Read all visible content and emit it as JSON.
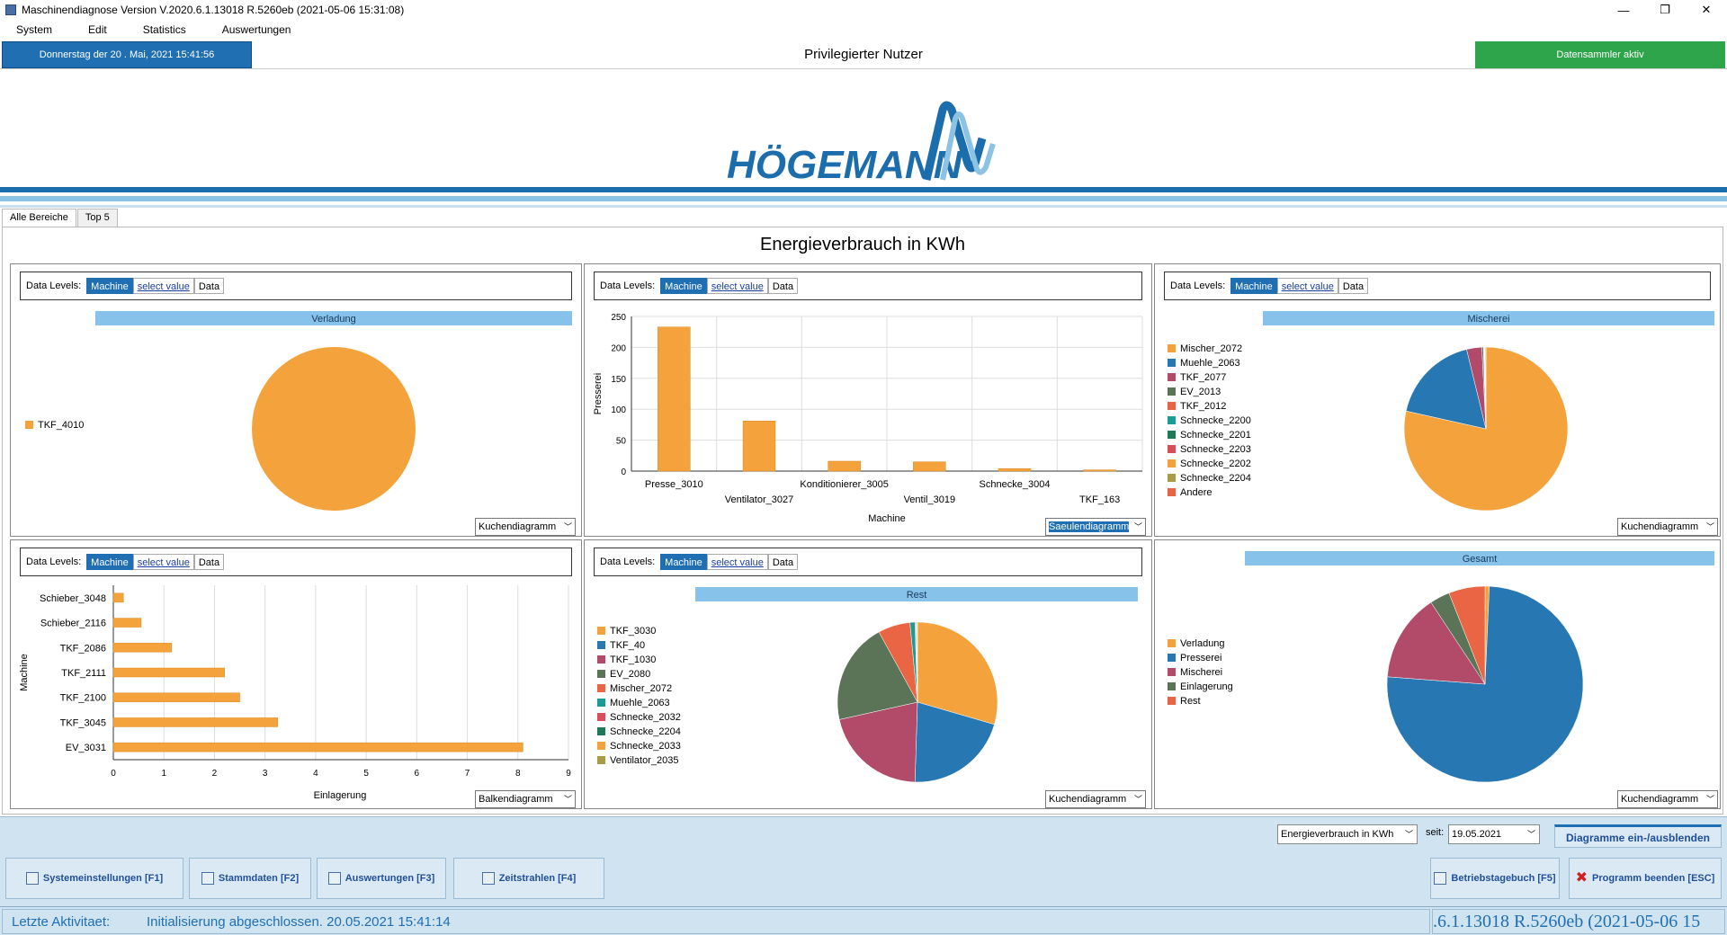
{
  "window": {
    "title": "Maschinendiagnose Version V.2020.6.1.13018 R.5260eb (2021-05-06 15:31:08)",
    "controls": [
      "—",
      "❐",
      "✕"
    ]
  },
  "menu": [
    "System",
    "Edit",
    "Statistics",
    "Auswertungen"
  ],
  "infobar": {
    "date": "Donnerstag  der  20 . Mai, 2021  15:41:56",
    "user": "Privilegierter Nutzer",
    "collector": "Datensammler aktiv"
  },
  "logo": {
    "text": "HÖGEMANN"
  },
  "tabs": [
    "Alle Bereiche",
    "Top 5"
  ],
  "main_title": "Energieverbrauch in KWh",
  "datalevels": {
    "label": "Data Levels:",
    "machine": "Machine",
    "select": "select value",
    "data": "Data"
  },
  "colors": {
    "orange": "#f4a23c",
    "blue": "#2677b2",
    "magenta": "#b24a6a",
    "green": "#5b7357",
    "red": "#ea6543",
    "teal": "#1a9c96",
    "darkgreen": "#1c7a58",
    "olive": "#a89c46",
    "header": "#86c2ea"
  },
  "panels": [
    {
      "header": "Verladung",
      "dropdown": "Kuchendiagramm",
      "chart_data": {
        "type": "pie",
        "title": "Verladung",
        "labels": [
          "TKF_4010"
        ],
        "values": [
          100
        ],
        "colors": [
          "#f4a23c"
        ]
      }
    },
    {
      "dropdown": "Saeulendiagramm",
      "chart_data": {
        "type": "bar",
        "xlabel": "Machine",
        "ylabel": "Presserei",
        "ylim": [
          0,
          250
        ],
        "yticks": [
          0,
          50,
          100,
          150,
          200,
          250
        ],
        "categories": [
          "Presse_3010",
          "Ventilator_3027",
          "Konditionierer_3005",
          "Ventil_3019",
          "Schnecke_3004",
          "TKF_163"
        ],
        "values": [
          233,
          81,
          16,
          15,
          4,
          2
        ]
      }
    },
    {
      "header": "Mischerei",
      "dropdown": "Kuchendiagramm",
      "chart_data": {
        "type": "pie",
        "title": "Mischerei",
        "labels": [
          "Mischer_2072",
          "Muehle_2063",
          "TKF_2077",
          "EV_2013",
          "TKF_2012",
          "Schnecke_2200",
          "Schnecke_2201",
          "Schnecke_2203",
          "Schnecke_2202",
          "Schnecke_2204",
          "Andere"
        ],
        "values": [
          78.5,
          17.7,
          3.0,
          0.3,
          0.1,
          0.05,
          0.05,
          0.05,
          0.05,
          0.1,
          0.1
        ],
        "colors": [
          "#f4a23c",
          "#2677b2",
          "#b24a6a",
          "#5b7357",
          "#ea6543",
          "#1a9c96",
          "#1c7a58",
          "#d94c5a",
          "#f4a23c",
          "#a89c46",
          "#ea6543"
        ]
      }
    },
    {
      "dropdown": "Balkendiagramm",
      "chart_data": {
        "type": "bar",
        "orientation": "horizontal",
        "xlabel": "Einlagerung",
        "ylabel": "Machine",
        "xlim": [
          0,
          9
        ],
        "xticks": [
          0,
          1,
          2,
          3,
          4,
          5,
          6,
          7,
          8,
          9
        ],
        "categories": [
          "Schieber_3048",
          "Schieber_2116",
          "TKF_2086",
          "TKF_2111",
          "TKF_2100",
          "TKF_3045",
          "EV_3031"
        ],
        "values": [
          0.2,
          0.55,
          1.15,
          2.2,
          2.5,
          3.25,
          8.1
        ]
      }
    },
    {
      "header": "Rest",
      "dropdown": "Kuchendiagramm",
      "chart_data": {
        "type": "pie",
        "title": "Rest",
        "labels": [
          "TKF_3030",
          "TKF_40",
          "TKF_1030",
          "EV_2080",
          "Mischer_2072",
          "Muehle_2063",
          "Schnecke_2032",
          "Schnecke_2204",
          "Schnecke_2033",
          "Ventilator_2035"
        ],
        "values": [
          29.5,
          21,
          21,
          20.5,
          6.5,
          1,
          0.15,
          0.15,
          0.1,
          0.1
        ],
        "colors": [
          "#f4a23c",
          "#2677b2",
          "#b24a6a",
          "#5b7357",
          "#ea6543",
          "#1a9c96",
          "#d94c5a",
          "#1c7a58",
          "#f4a23c",
          "#a89c46"
        ]
      }
    },
    {
      "header": "Gesamt",
      "dropdown": "Kuchendiagramm",
      "chart_data": {
        "type": "pie",
        "title": "Gesamt",
        "labels": [
          "Verladung",
          "Presserei",
          "Mischerei",
          "Einlagerung",
          "Rest"
        ],
        "values": [
          0.7,
          75.5,
          14.5,
          3.3,
          6.0
        ],
        "colors": [
          "#f4a23c",
          "#2677b2",
          "#b24a6a",
          "#5b7357",
          "#ea6543"
        ]
      }
    }
  ],
  "controls": {
    "metric": "Energieverbrauch in KWh",
    "seit_label": "seit:",
    "seit_date": "19.05.2021",
    "toggle": "Diagramme ein-/ausblenden"
  },
  "buttons": {
    "systemeinstellungen": "Systemeinstellungen [F1]",
    "stammdaten": "Stammdaten [F2]",
    "auswertungen": "Auswertungen [F3]",
    "zeitstrahlen": "Zeitstrahlen [F4]",
    "betriebstagebuch": "Betriebstagebuch [F5]",
    "beenden": "Programm beenden [ESC]"
  },
  "status": {
    "label": "Letzte Aktivitaet:",
    "text": "Initialisierung abgeschlossen. 20.05.2021 15:41:14",
    "version": ".6.1.13018 R.5260eb (2021-05-06 15"
  }
}
